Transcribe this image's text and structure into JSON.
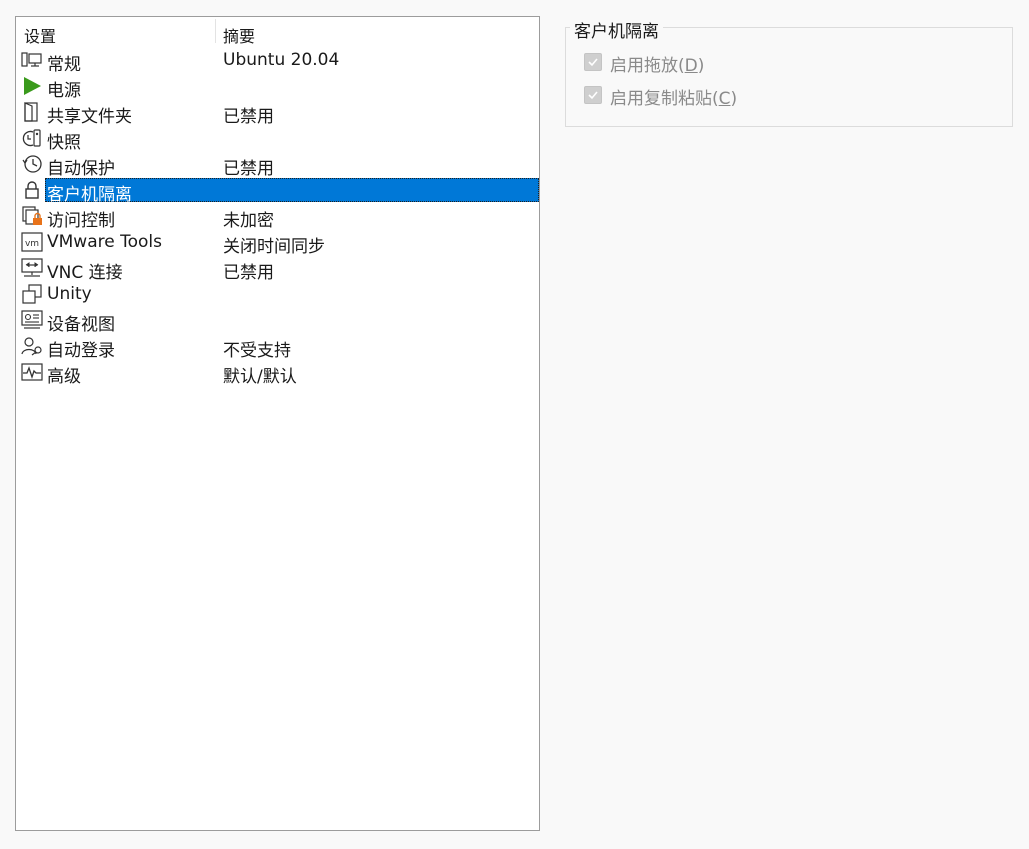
{
  "columns": {
    "settings": "设置",
    "summary": "摘要"
  },
  "items": [
    {
      "icon": "monitor-icon",
      "label": "常规",
      "summary": "Ubuntu 20.04"
    },
    {
      "icon": "play-icon",
      "label": "电源",
      "summary": ""
    },
    {
      "icon": "shared-folder-icon",
      "label": "共享文件夹",
      "summary": "已禁用"
    },
    {
      "icon": "snapshot-icon",
      "label": "快照",
      "summary": ""
    },
    {
      "icon": "clock-icon",
      "label": "自动保护",
      "summary": "已禁用"
    },
    {
      "icon": "lock-icon",
      "label": "客户机隔离",
      "summary": "",
      "selected": true
    },
    {
      "icon": "access-control-icon",
      "label": "访问控制",
      "summary": "未加密"
    },
    {
      "icon": "vm-icon",
      "label": "VMware Tools",
      "summary": "关闭时间同步"
    },
    {
      "icon": "vnc-icon",
      "label": "VNC 连接",
      "summary": "已禁用"
    },
    {
      "icon": "unity-icon",
      "label": "Unity",
      "summary": ""
    },
    {
      "icon": "appliance-view-icon",
      "label": "设备视图",
      "summary": ""
    },
    {
      "icon": "autologin-icon",
      "label": "自动登录",
      "summary": "不受支持"
    },
    {
      "icon": "advanced-icon",
      "label": "高级",
      "summary": "默认/默认"
    }
  ],
  "isolation": {
    "title": "客户机隔离",
    "drag_drop": {
      "label": "启用拖放(",
      "key": "D",
      "suffix": ")",
      "checked": true,
      "enabled": false
    },
    "copy_paste": {
      "label": "启用复制粘贴(",
      "key": "C",
      "suffix": ")",
      "checked": true,
      "enabled": false
    }
  },
  "colors": {
    "selection": "#0078d7",
    "play_icon": "#3a9a1c",
    "lock_badge": "#e8731a"
  }
}
